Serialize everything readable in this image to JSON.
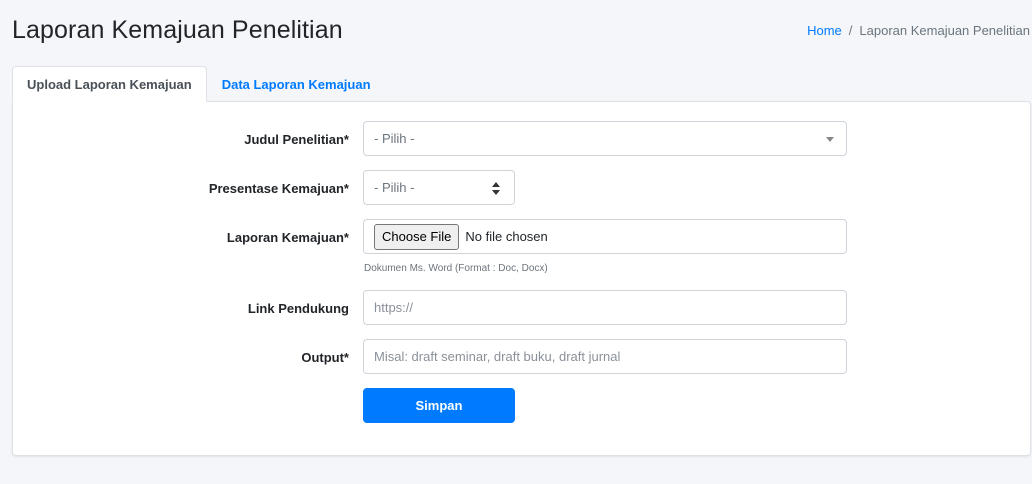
{
  "header": {
    "title": "Laporan Kemajuan Penelitian",
    "breadcrumb": {
      "home": "Home",
      "separator": "/",
      "current": "Laporan Kemajuan Penelitian"
    }
  },
  "tabs": [
    {
      "label": "Upload Laporan Kemajuan",
      "active": true
    },
    {
      "label": "Data Laporan Kemajuan",
      "active": false
    }
  ],
  "form": {
    "judul": {
      "label": "Judul Penelitian*",
      "value": "- Pilih -"
    },
    "presentase": {
      "label": "Presentase Kemajuan*",
      "value": "- Pilih -"
    },
    "laporan": {
      "label": "Laporan Kemajuan*",
      "button": "Choose File",
      "status": "No file chosen",
      "help": "Dokumen Ms. Word (Format : Doc, Docx)"
    },
    "link": {
      "label": "Link Pendukung",
      "placeholder": "https://"
    },
    "output": {
      "label": "Output*",
      "placeholder": "Misal: draft seminar, draft buku, draft jurnal"
    },
    "submit": "Simpan"
  },
  "colors": {
    "primary": "#007bff",
    "background": "#f4f6f9",
    "card": "#ffffff"
  }
}
